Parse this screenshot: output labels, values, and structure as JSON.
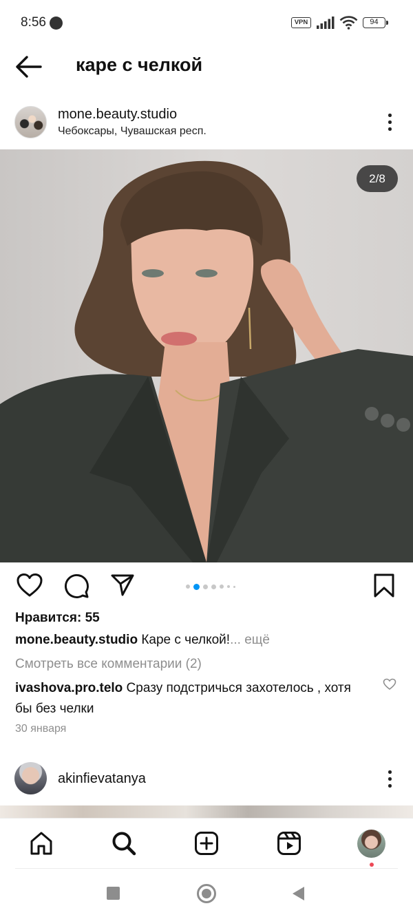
{
  "status_bar": {
    "time": "8:56",
    "vpn": "VPN",
    "battery": "94"
  },
  "top_bar": {
    "title": "каре с челкой"
  },
  "post": {
    "username": "mone.beauty.studio",
    "location": "Чебоксары, Чувашская респ.",
    "carousel_counter": "2/8",
    "carousel": {
      "current": 2,
      "total": 8
    },
    "likes": "Нравится: 55",
    "caption_user": "mone.beauty.studio",
    "caption_text": " Каре с челкой!",
    "caption_more": "... ещё",
    "view_comments": "Смотреть все комментарии (2)",
    "comment_user": "ivashova.pro.telo",
    "comment_text": " Сразу подстричься захотелось , хотя бы без челки",
    "date": "30 января"
  },
  "next_post": {
    "username": "akinfievatanya"
  },
  "bottom_nav": {
    "items": [
      "home-icon",
      "search-icon",
      "new-post-icon",
      "reels-icon",
      "profile-avatar"
    ],
    "active": "search-icon",
    "notification_color": "#ed4956"
  },
  "colors": {
    "accent": "#0095f6",
    "secondary_text": "#8e8e8e"
  }
}
